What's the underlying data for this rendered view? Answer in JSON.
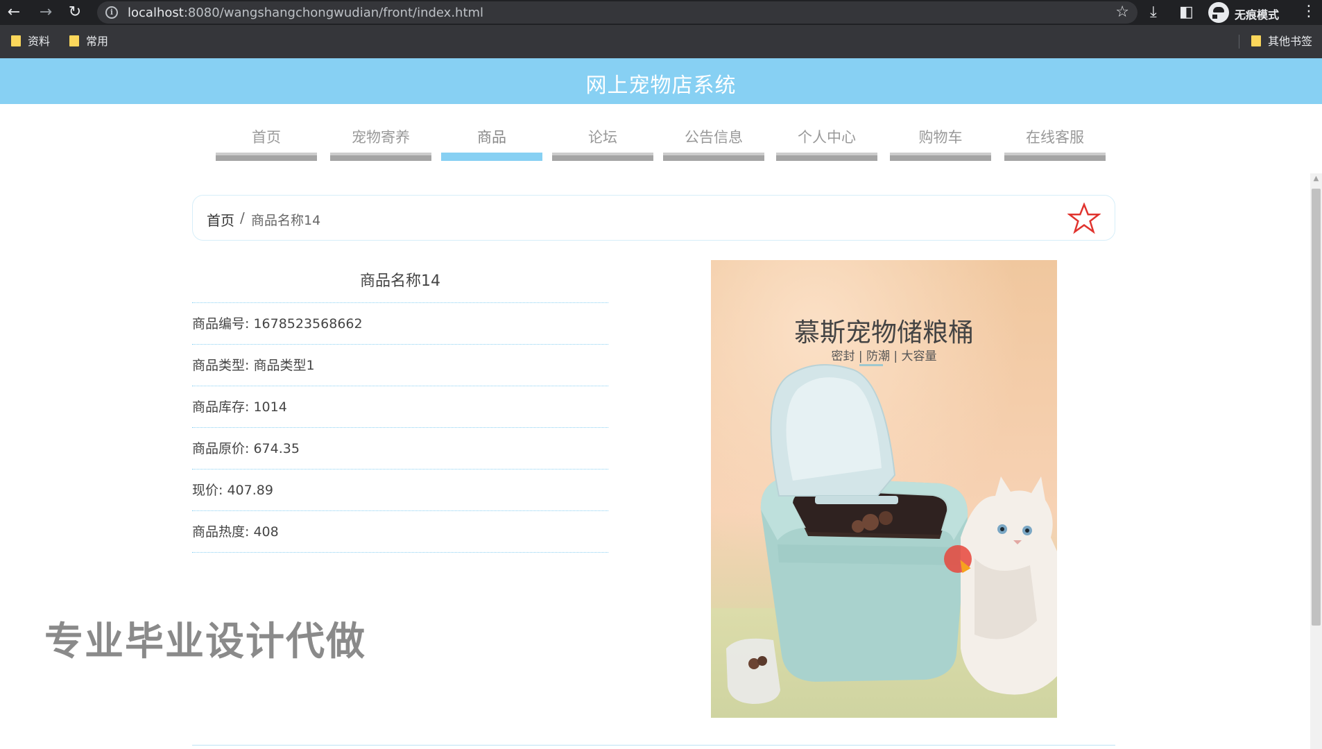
{
  "browser": {
    "url_host": "localhost",
    "url_rest": ":8080/wangshangchongwudian/front/index.html",
    "incognito_label": "无痕模式",
    "bookmarks": [
      "资料",
      "常用"
    ],
    "other_bookmarks": "其他书签"
  },
  "site": {
    "title": "网上宠物店系统"
  },
  "nav": {
    "items": [
      {
        "label": "首页"
      },
      {
        "label": "宠物寄养"
      },
      {
        "label": "商品"
      },
      {
        "label": "论坛"
      },
      {
        "label": "公告信息"
      },
      {
        "label": "个人中心"
      },
      {
        "label": "购物车"
      },
      {
        "label": "在线客服"
      }
    ],
    "active_index": 2,
    "active_color": "#87d0f3"
  },
  "breadcrumb": {
    "home": "首页",
    "separator": "/",
    "current": "商品名称14"
  },
  "product": {
    "name": "商品名称14",
    "fields": [
      "商品编号: 1678523568662",
      "商品类型: 商品类型1",
      "商品库存: 1014",
      "商品原价: 674.35",
      "现价: 407.89",
      "商品热度: 408"
    ],
    "image": {
      "title": "慕斯宠物储粮桶",
      "subtitle": "密封 | 防潮 | 大容量"
    }
  },
  "watermark": "专业毕业设计代做",
  "colors": {
    "header_bg": "#87d0f3",
    "star_outline": "#e0332e"
  },
  "icons": {
    "favorite": "star-outline-icon"
  }
}
